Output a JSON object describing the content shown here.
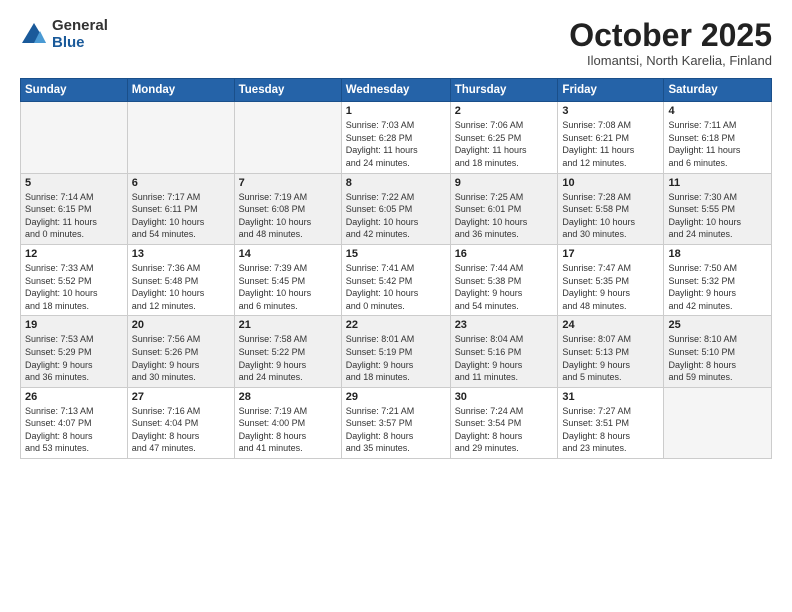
{
  "logo": {
    "general": "General",
    "blue": "Blue"
  },
  "header": {
    "month": "October 2025",
    "location": "Ilomantsi, North Karelia, Finland"
  },
  "weekdays": [
    "Sunday",
    "Monday",
    "Tuesday",
    "Wednesday",
    "Thursday",
    "Friday",
    "Saturday"
  ],
  "weeks": [
    [
      {
        "day": "",
        "info": ""
      },
      {
        "day": "",
        "info": ""
      },
      {
        "day": "",
        "info": ""
      },
      {
        "day": "1",
        "info": "Sunrise: 7:03 AM\nSunset: 6:28 PM\nDaylight: 11 hours\nand 24 minutes."
      },
      {
        "day": "2",
        "info": "Sunrise: 7:06 AM\nSunset: 6:25 PM\nDaylight: 11 hours\nand 18 minutes."
      },
      {
        "day": "3",
        "info": "Sunrise: 7:08 AM\nSunset: 6:21 PM\nDaylight: 11 hours\nand 12 minutes."
      },
      {
        "day": "4",
        "info": "Sunrise: 7:11 AM\nSunset: 6:18 PM\nDaylight: 11 hours\nand 6 minutes."
      }
    ],
    [
      {
        "day": "5",
        "info": "Sunrise: 7:14 AM\nSunset: 6:15 PM\nDaylight: 11 hours\nand 0 minutes."
      },
      {
        "day": "6",
        "info": "Sunrise: 7:17 AM\nSunset: 6:11 PM\nDaylight: 10 hours\nand 54 minutes."
      },
      {
        "day": "7",
        "info": "Sunrise: 7:19 AM\nSunset: 6:08 PM\nDaylight: 10 hours\nand 48 minutes."
      },
      {
        "day": "8",
        "info": "Sunrise: 7:22 AM\nSunset: 6:05 PM\nDaylight: 10 hours\nand 42 minutes."
      },
      {
        "day": "9",
        "info": "Sunrise: 7:25 AM\nSunset: 6:01 PM\nDaylight: 10 hours\nand 36 minutes."
      },
      {
        "day": "10",
        "info": "Sunrise: 7:28 AM\nSunset: 5:58 PM\nDaylight: 10 hours\nand 30 minutes."
      },
      {
        "day": "11",
        "info": "Sunrise: 7:30 AM\nSunset: 5:55 PM\nDaylight: 10 hours\nand 24 minutes."
      }
    ],
    [
      {
        "day": "12",
        "info": "Sunrise: 7:33 AM\nSunset: 5:52 PM\nDaylight: 10 hours\nand 18 minutes."
      },
      {
        "day": "13",
        "info": "Sunrise: 7:36 AM\nSunset: 5:48 PM\nDaylight: 10 hours\nand 12 minutes."
      },
      {
        "day": "14",
        "info": "Sunrise: 7:39 AM\nSunset: 5:45 PM\nDaylight: 10 hours\nand 6 minutes."
      },
      {
        "day": "15",
        "info": "Sunrise: 7:41 AM\nSunset: 5:42 PM\nDaylight: 10 hours\nand 0 minutes."
      },
      {
        "day": "16",
        "info": "Sunrise: 7:44 AM\nSunset: 5:38 PM\nDaylight: 9 hours\nand 54 minutes."
      },
      {
        "day": "17",
        "info": "Sunrise: 7:47 AM\nSunset: 5:35 PM\nDaylight: 9 hours\nand 48 minutes."
      },
      {
        "day": "18",
        "info": "Sunrise: 7:50 AM\nSunset: 5:32 PM\nDaylight: 9 hours\nand 42 minutes."
      }
    ],
    [
      {
        "day": "19",
        "info": "Sunrise: 7:53 AM\nSunset: 5:29 PM\nDaylight: 9 hours\nand 36 minutes."
      },
      {
        "day": "20",
        "info": "Sunrise: 7:56 AM\nSunset: 5:26 PM\nDaylight: 9 hours\nand 30 minutes."
      },
      {
        "day": "21",
        "info": "Sunrise: 7:58 AM\nSunset: 5:22 PM\nDaylight: 9 hours\nand 24 minutes."
      },
      {
        "day": "22",
        "info": "Sunrise: 8:01 AM\nSunset: 5:19 PM\nDaylight: 9 hours\nand 18 minutes."
      },
      {
        "day": "23",
        "info": "Sunrise: 8:04 AM\nSunset: 5:16 PM\nDaylight: 9 hours\nand 11 minutes."
      },
      {
        "day": "24",
        "info": "Sunrise: 8:07 AM\nSunset: 5:13 PM\nDaylight: 9 hours\nand 5 minutes."
      },
      {
        "day": "25",
        "info": "Sunrise: 8:10 AM\nSunset: 5:10 PM\nDaylight: 8 hours\nand 59 minutes."
      }
    ],
    [
      {
        "day": "26",
        "info": "Sunrise: 7:13 AM\nSunset: 4:07 PM\nDaylight: 8 hours\nand 53 minutes."
      },
      {
        "day": "27",
        "info": "Sunrise: 7:16 AM\nSunset: 4:04 PM\nDaylight: 8 hours\nand 47 minutes."
      },
      {
        "day": "28",
        "info": "Sunrise: 7:19 AM\nSunset: 4:00 PM\nDaylight: 8 hours\nand 41 minutes."
      },
      {
        "day": "29",
        "info": "Sunrise: 7:21 AM\nSunset: 3:57 PM\nDaylight: 8 hours\nand 35 minutes."
      },
      {
        "day": "30",
        "info": "Sunrise: 7:24 AM\nSunset: 3:54 PM\nDaylight: 8 hours\nand 29 minutes."
      },
      {
        "day": "31",
        "info": "Sunrise: 7:27 AM\nSunset: 3:51 PM\nDaylight: 8 hours\nand 23 minutes."
      },
      {
        "day": "",
        "info": ""
      }
    ]
  ]
}
